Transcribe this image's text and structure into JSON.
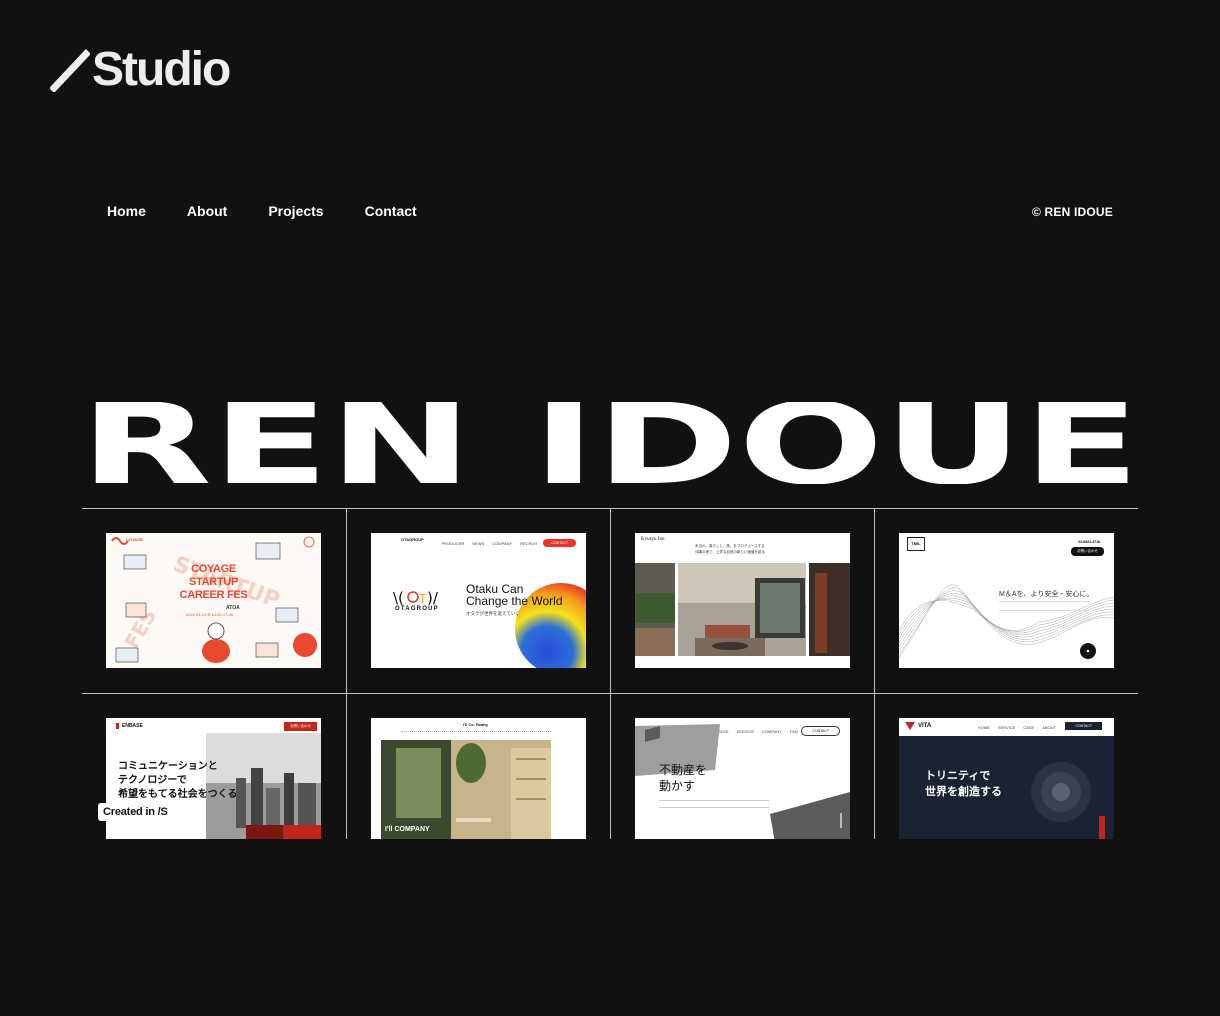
{
  "brand": {
    "logo_text": "Studio"
  },
  "nav": {
    "items": [
      "Home",
      "About",
      "Projects",
      "Contact"
    ]
  },
  "copyright": "© REN IDOUE",
  "hero": {
    "name": "REN IDOUE"
  },
  "projects": [
    {
      "title_lines": [
        "COYAGE",
        "STARTUP",
        "CAREER FES"
      ],
      "brand": "COYAGE",
      "date": "2024.04.24 ⊕ 14:00-17:30",
      "sponsor": "ATOA"
    },
    {
      "brand": "OTAGROUP",
      "headline_lines": [
        "Otaku Can",
        "Change the World"
      ],
      "sub": "オタクが世界を変えていく",
      "nav": [
        "PRODUCER",
        "NEWS",
        "COMPANY",
        "RECRUIT"
      ],
      "cta": "CONTACT"
    },
    {
      "brand": "Kyusyu Inn",
      "tagline_lines": [
        "本当の、暮らしと、旅、をプロデュースする",
        "沖縄の地で、上質な自然の新しい価値を創る"
      ]
    },
    {
      "brand": "TMIL Corporate",
      "headline": "M＆Aを、より安全・安心に。",
      "phone": "03-6824-3716",
      "cta": "お問い合わせ"
    },
    {
      "brand": "ENBASE",
      "headline_lines": [
        "コミュニケーションと",
        "テクノロジーで",
        "希望をもてる社会をつくる"
      ],
      "cta": "お問い合わせ"
    },
    {
      "brand": "I'll Co. Realty",
      "caption": "I'll COMPANY"
    },
    {
      "headline_lines": [
        "不動産を",
        "動かす"
      ],
      "nav": [
        "ADVANTAGE",
        "SERVICE",
        "COMPANY",
        "FAQ"
      ],
      "cta": "CONTACT"
    },
    {
      "brand": "VITA",
      "headline_lines": [
        "トリニティで",
        "世界を創造する"
      ],
      "nav": [
        "HOME",
        "SERVICE",
        "CASE",
        "ABOUT"
      ],
      "cta": "CONTACT"
    }
  ],
  "created_badge": "Created in /S"
}
